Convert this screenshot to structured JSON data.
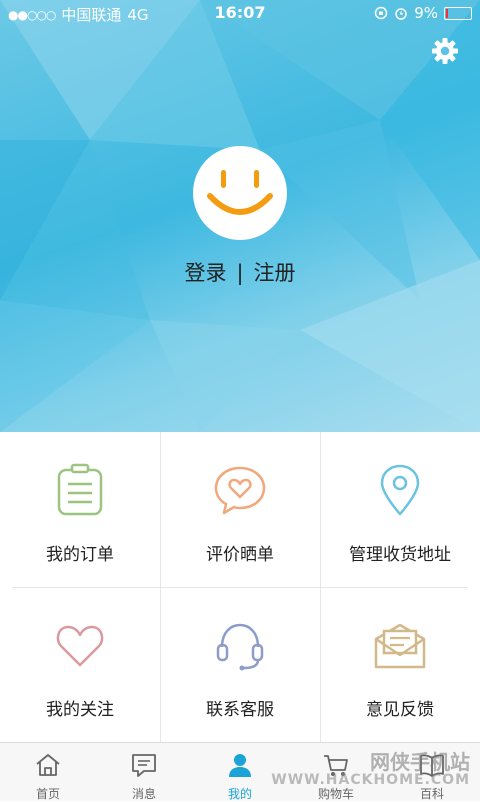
{
  "status_bar": {
    "signal": "●●○○○",
    "carrier": "中国联通",
    "network": "4G",
    "time": "16:07",
    "battery": "9%",
    "battery_level": 0.09
  },
  "header": {
    "settings_icon": "gear-icon",
    "avatar_icon": "smiley-face-icon",
    "login_label": "登录",
    "separator": "|",
    "register_label": "注册"
  },
  "menu": [
    {
      "label": "我的订单",
      "icon": "clipboard-icon",
      "color": "#9cc47f"
    },
    {
      "label": "评价晒单",
      "icon": "heart-chat-bubble-icon",
      "color": "#f0a87d"
    },
    {
      "label": "管理收货地址",
      "icon": "location-pin-icon",
      "color": "#6cc3df"
    },
    {
      "label": "我的关注",
      "icon": "heart-icon",
      "color": "#d99a9e"
    },
    {
      "label": "联系客服",
      "icon": "headset-icon",
      "color": "#8d9dc8"
    },
    {
      "label": "意见反馈",
      "icon": "envelope-letter-icon",
      "color": "#d1b98a"
    }
  ],
  "tabs": [
    {
      "label": "首页",
      "icon": "home-icon"
    },
    {
      "label": "消息",
      "icon": "message-icon"
    },
    {
      "label": "我的",
      "icon": "person-icon",
      "active": true
    },
    {
      "label": "购物车",
      "icon": "cart-icon"
    },
    {
      "label": "百科",
      "icon": "book-icon"
    }
  ],
  "watermark": {
    "line1": "网侠手机站",
    "line2": "WWW.HACKHOME.COM"
  },
  "colors": {
    "accent": "#1aa3d6",
    "avatar_face": "#f39c12"
  }
}
